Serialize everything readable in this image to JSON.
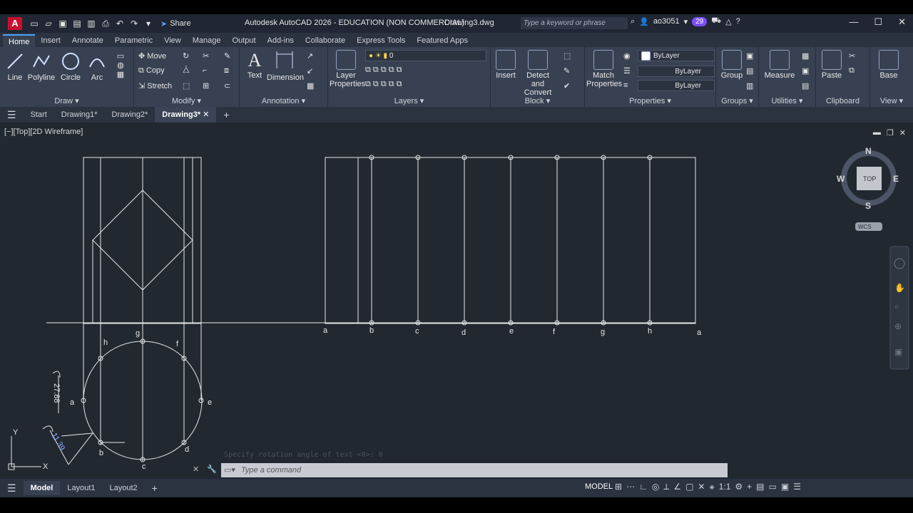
{
  "titlebar": {
    "app_letter": "A",
    "share_label": "Share",
    "app_title": "Autodesk AutoCAD 2026 - EDUCATION (NON COMMERCIAL)",
    "file_name": "Drawing3.dwg",
    "search_placeholder": "Type a keyword or phrase",
    "user": "ao3051",
    "notif_count": "29"
  },
  "tabs": [
    "Home",
    "Insert",
    "Annotate",
    "Parametric",
    "View",
    "Manage",
    "Output",
    "Add-ins",
    "Collaborate",
    "Express Tools",
    "Featured Apps"
  ],
  "ribbon": {
    "draw": {
      "title": "Draw",
      "line": "Line",
      "polyline": "Polyline",
      "circle": "Circle",
      "arc": "Arc"
    },
    "modify": {
      "title": "Modify",
      "move": "Move",
      "copy": "Copy",
      "stretch": "Stretch"
    },
    "annotation": {
      "title": "Annotation",
      "text": "Text",
      "dimension": "Dimension"
    },
    "layers": {
      "title": "Layers",
      "layer_properties_1": "Layer",
      "layer_properties_2": "Properties",
      "current_layer": "0"
    },
    "block": {
      "title": "Block",
      "insert": "Insert",
      "detect_1": "Detect and",
      "detect_2": "Convert"
    },
    "properties": {
      "title": "Properties",
      "match_1": "Match",
      "match_2": "Properties",
      "color": "ByLayer",
      "linetype": "ByLayer",
      "lineweight": "ByLayer"
    },
    "groups": {
      "title": "Groups",
      "group": "Group"
    },
    "utilities": {
      "title": "Utilities",
      "measure": "Measure"
    },
    "clipboard": {
      "title": "Clipboard",
      "paste": "Paste"
    },
    "view": {
      "title": "View",
      "base": "Base"
    }
  },
  "filetabs": {
    "start": "Start",
    "d1": "Drawing1*",
    "d2": "Drawing2*",
    "d3": "Drawing3*"
  },
  "viewport": {
    "label": "[−][Top][2D Wireframe]",
    "viewcube": {
      "n": "N",
      "s": "S",
      "e": "E",
      "w": "W",
      "top": "TOP",
      "wcs": "WCS"
    },
    "labels_top_row": [
      "a",
      "b",
      "c",
      "d",
      "e",
      "f",
      "g",
      "h",
      "a"
    ],
    "circle_labels": {
      "g": "g",
      "h": "h",
      "f": "f",
      "a": "a",
      "e": "e",
      "b": "b",
      "d": "d",
      "c": "c"
    },
    "dim_text_1": "27.88",
    "dim_text_2": "11.39",
    "axis_y": "Y",
    "axis_x": "X",
    "ghost_prompt": "Specify rotation angle of text <0>: 0",
    "command_placeholder": "Type a command"
  },
  "statusbar": {
    "model_tab": "Model",
    "layout1": "Layout1",
    "layout2": "Layout2",
    "model_label": "MODEL",
    "scale": "1:1"
  }
}
